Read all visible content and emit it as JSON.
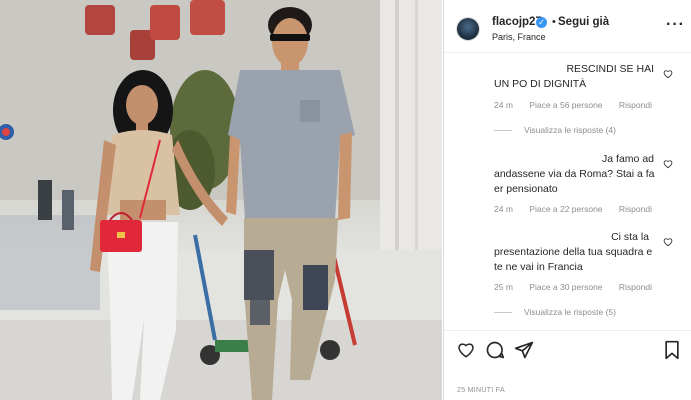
{
  "post": {
    "username": "flacojp27",
    "follow": "Segui già",
    "location": "Paris, France",
    "time_ago": "25 MINUTI FA"
  },
  "comments": [
    {
      "text_lines": [
        "RESCINDI SE HAI",
        "UN PO DI DIGNITÀ"
      ],
      "time": "24 m",
      "likes": "Piace a 56 persone",
      "reply": "Rispondi",
      "view_replies": "Visualizza le risposte (4)"
    },
    {
      "text_lines": [
        "Ja famo ad",
        "andassene via da Roma? Stai a fa",
        "er pensionato"
      ],
      "time": "24 m",
      "likes": "Piace a 22 persone",
      "reply": "Rispondi"
    },
    {
      "text_lines": [
        "Ci sta la",
        "presentazione della tua squadra e",
        "te ne vai in Francia"
      ],
      "time": "25 m",
      "likes": "Piace a 30 persone",
      "reply": "Rispondi",
      "view_replies": "Visualizza le risposte (5)"
    }
  ],
  "icons": {
    "like": "heart-icon",
    "comment": "comment-icon",
    "share": "share-icon",
    "save": "bookmark-icon",
    "more": "more-options-icon"
  },
  "colors": {
    "verified": "#3897f0",
    "bag": "#e0283a",
    "muted_text": "#8e8e8e"
  }
}
